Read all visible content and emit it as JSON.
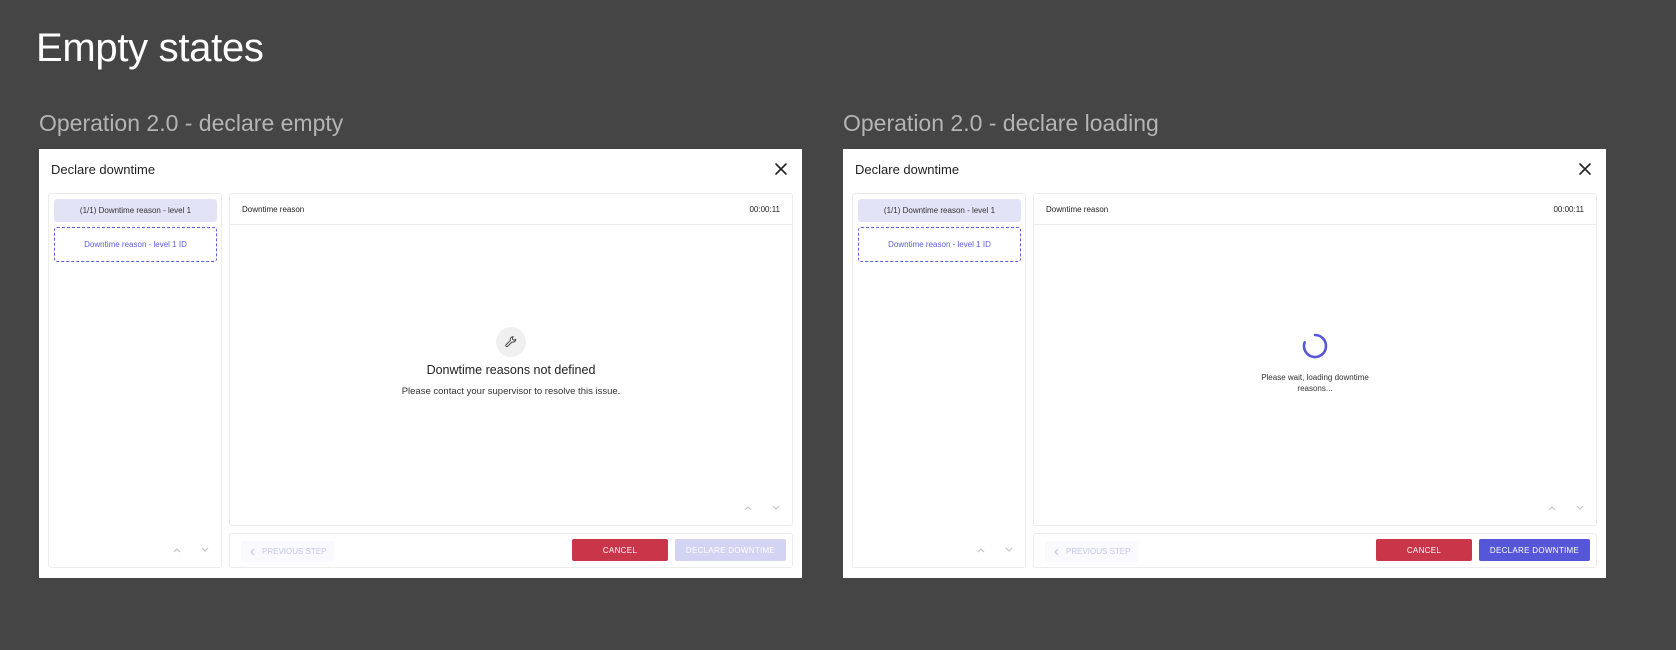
{
  "page_title": "Empty states",
  "frames": [
    {
      "label": "Operation 2.0 - declare empty",
      "modal_title": "Declare downtime",
      "close_icon": "close-icon",
      "sidebar": {
        "active_step": "(1/1) Downtime reason - level 1",
        "pending_step": "Downtime reason - level 1 ID"
      },
      "panel": {
        "header_label": "Downtime reason",
        "timer": "00:00:11",
        "state": "empty",
        "empty_icon": "wrench-icon",
        "empty_title": "Donwtime reasons not defined",
        "empty_subtitle": "Please contact your supervisor to resolve this issue."
      },
      "footer": {
        "previous_label": "PREVIOUS STEP",
        "cancel_label": "CANCEL",
        "declare_label": "DECLARE DOWNTIME",
        "declare_enabled": false
      }
    },
    {
      "label": "Operation 2.0 - declare loading",
      "modal_title": "Declare downtime",
      "close_icon": "close-icon",
      "sidebar": {
        "active_step": "(1/1) Downtime reason - level 1",
        "pending_step": "Downtime reason - level 1 ID"
      },
      "panel": {
        "header_label": "Downtime reason",
        "timer": "00:00:11",
        "state": "loading",
        "loading_text": "Please wait, loading downtime reasons..."
      },
      "footer": {
        "previous_label": "PREVIOUS STEP",
        "cancel_label": "CANCEL",
        "declare_label": "DECLARE DOWNTIME",
        "declare_enabled": true
      }
    }
  ],
  "colors": {
    "background": "#454545",
    "accent": "#5557d8",
    "danger": "#c9364a",
    "disabled": "#d3d3f4",
    "step_pill": "#e3e3f7"
  }
}
